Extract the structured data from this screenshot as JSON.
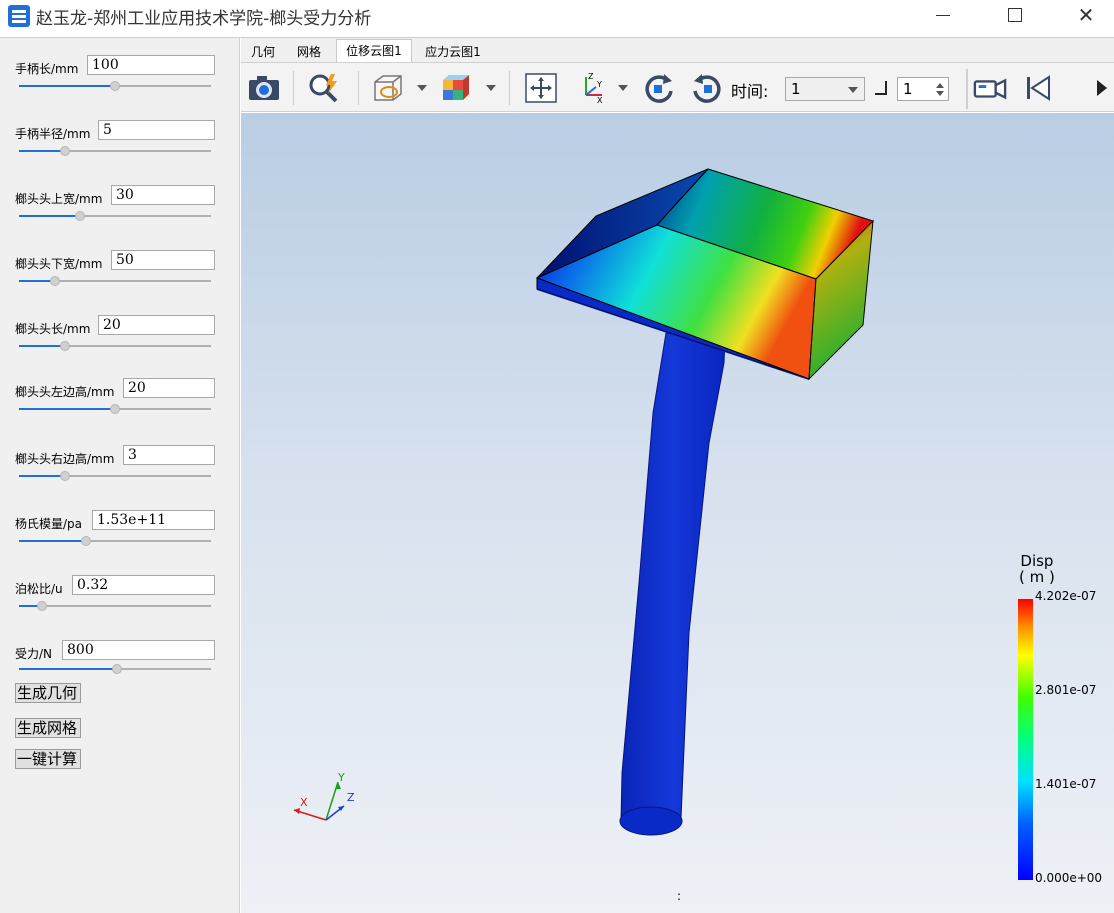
{
  "window": {
    "title": "赵玉龙-郑州工业应用技术学院-榔头受力分析"
  },
  "params": [
    {
      "label": "手柄长/mm",
      "value": "100",
      "slider_fraction": 0.5
    },
    {
      "label": "手柄半径/mm",
      "value": "5",
      "slider_fraction": 0.24
    },
    {
      "label": "榔头头上宽/mm",
      "value": "30",
      "slider_fraction": 0.32
    },
    {
      "label": "榔头头下宽/mm",
      "value": "50",
      "slider_fraction": 0.19
    },
    {
      "label": "榔头头长/mm",
      "value": "20",
      "slider_fraction": 0.24
    },
    {
      "label": "榔头头左边高/mm",
      "value": "20",
      "slider_fraction": 0.5
    },
    {
      "label": "榔头头右边高/mm",
      "value": "3",
      "slider_fraction": 0.24
    },
    {
      "label": "杨氏模量/pa",
      "value": "1.53e+11",
      "slider_fraction": 0.35
    },
    {
      "label": "泊松比/u",
      "value": "0.32",
      "slider_fraction": 0.12
    },
    {
      "label": "受力/N",
      "value": "800",
      "slider_fraction": 0.51
    }
  ],
  "actions": {
    "generate_geometry": "生成几何",
    "generate_mesh": "生成网格",
    "one_click_compute": "一键计算"
  },
  "tabs": [
    {
      "label": "几何",
      "active": false
    },
    {
      "label": "网格",
      "active": false
    },
    {
      "label": "位移云图1",
      "active": true
    },
    {
      "label": "应力云图1",
      "active": false
    }
  ],
  "toolbar": {
    "time_label": "时间:",
    "time_value": "1",
    "step_value": "1"
  },
  "legend": {
    "title": "Disp",
    "unit": "( m )",
    "max": "4.202e-07",
    "upper_mid": "2.801e-07",
    "lower_mid": "1.401e-07",
    "min": "0.000e+00"
  },
  "triad": {
    "x": "X",
    "y": "Y",
    "z": "Z"
  },
  "status_mark": ":",
  "colors": {
    "accent": "#1e6fd9",
    "disp_high": "#ff0000",
    "disp_low": "#0000ff"
  }
}
